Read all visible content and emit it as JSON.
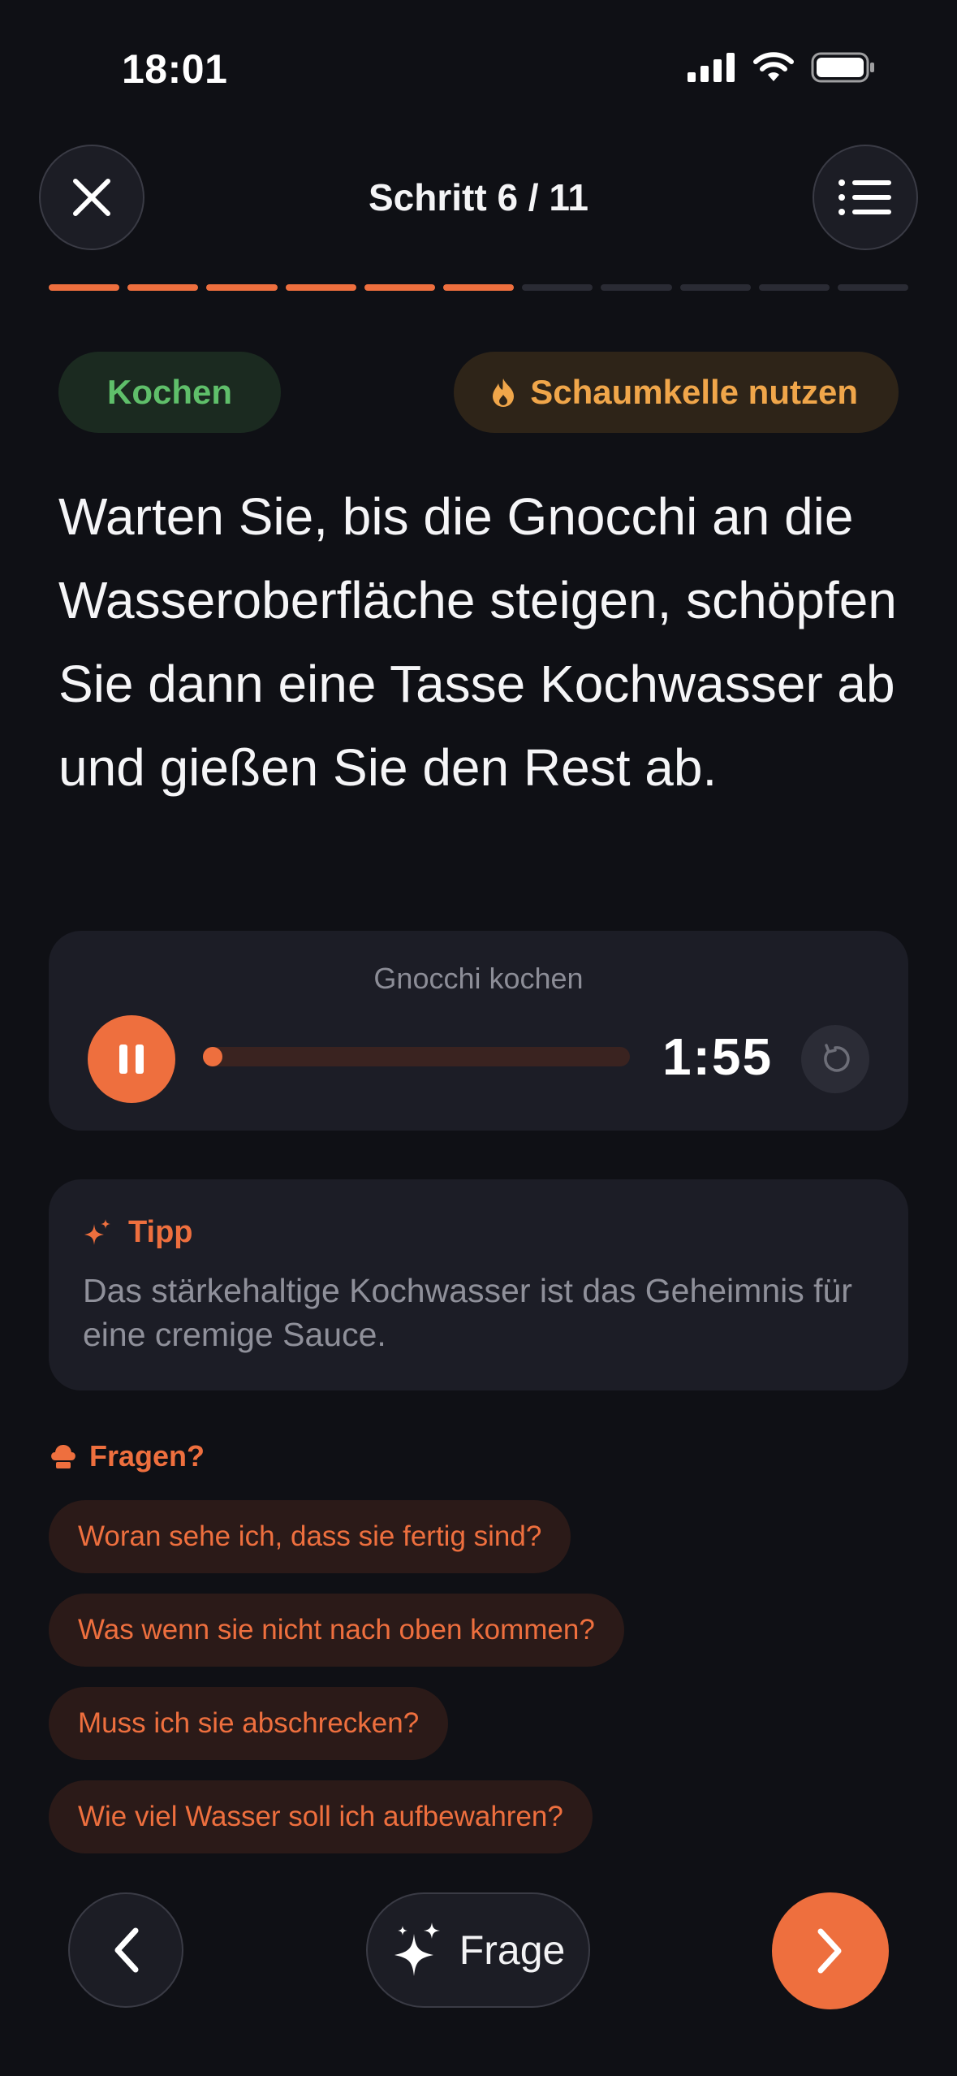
{
  "status_bar": {
    "time": "18:01"
  },
  "header": {
    "step_title": "Schritt 6 / 11"
  },
  "progress": {
    "current": 6,
    "total": 11
  },
  "chips": {
    "category": "Kochen",
    "tool": "Schaumkelle nutzen"
  },
  "instruction": "Warten Sie, bis die Gnocchi an die Wasseroberfläche steigen, schöpfen Sie dann eine Tasse Kochwasser ab und gießen Sie den Rest ab.",
  "timer": {
    "label": "Gnocchi kochen",
    "time": "1:55",
    "progress": 0.02
  },
  "tip": {
    "title": "Tipp",
    "text": "Das stärkehaltige Kochwasser ist das Geheimnis für eine cremige Sauce."
  },
  "questions": {
    "title": "Fragen?",
    "items": [
      "Woran sehe ich, dass sie fertig sind?",
      "Was wenn sie nicht nach oben kommen?",
      "Muss ich sie abschrecken?",
      "Wie viel Wasser soll ich aufbewahren?"
    ]
  },
  "bottom_nav": {
    "ask_label": "Frage"
  },
  "colors": {
    "accent": "#ee6f3e",
    "green": "#5fbf6a",
    "amber": "#f0a64a",
    "background": "#0f1015"
  },
  "icons": {
    "close": "close-icon",
    "menu": "list-icon",
    "flame": "flame-icon",
    "pause": "pause-icon",
    "reset": "reset-icon",
    "sparkle": "sparkle-icon",
    "chef": "chef-hat-icon",
    "back": "chevron-left-icon",
    "next": "chevron-right-icon"
  }
}
